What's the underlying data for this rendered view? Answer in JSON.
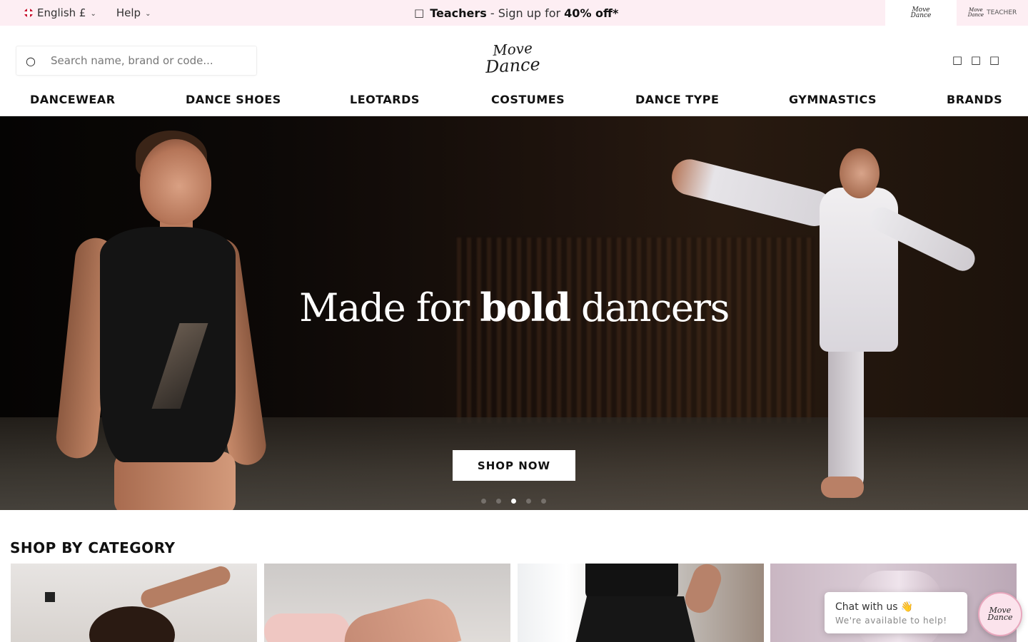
{
  "topbar": {
    "language": "English £",
    "help": "Help",
    "promo": {
      "strong": "Teachers",
      "middle": " - Sign up for ",
      "offer": "40% off*"
    },
    "teacher_label": "TEACHER"
  },
  "brand": {
    "line1": "Move",
    "line2": "Dance"
  },
  "search": {
    "placeholder": "Search name, brand or code..."
  },
  "nav": [
    "DANCEWEAR",
    "DANCE SHOES",
    "LEOTARDS",
    "COSTUMES",
    "DANCE TYPE",
    "GYMNASTICS",
    "BRANDS"
  ],
  "hero": {
    "title_pre": "Made for ",
    "title_bold": "bold",
    "title_post": " dancers",
    "cta": "SHOP NOW",
    "slide_count": 5,
    "active_slide": 3
  },
  "category_section": {
    "title": "SHOP BY CATEGORY"
  },
  "chat": {
    "title": "Chat with us 👋",
    "subtitle": "We're available to help!"
  },
  "icons": {
    "gift": "gift-icon",
    "search": "search-icon",
    "account": "user-icon",
    "wishlist": "heart-icon",
    "basket": "bag-icon"
  },
  "colors": {
    "topbar_bg": "#fdeef3",
    "accent": "#e8a7bd",
    "text": "#111111"
  }
}
